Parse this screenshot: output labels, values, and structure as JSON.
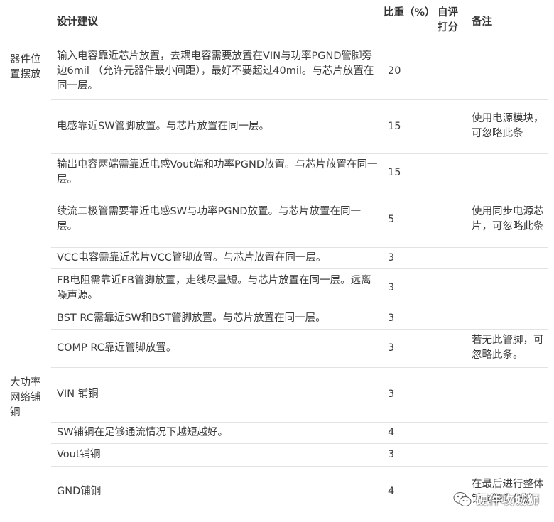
{
  "header": {
    "suggestion": "设计建议",
    "weight": "比重（%）",
    "self_score": "自评打分",
    "note": "备注"
  },
  "groups": [
    {
      "category": "器件位置摆放",
      "rows": [
        {
          "suggestion": "输入电容靠近芯片放置，去耦电容需要放置在VIN与功率PGND管脚旁边6mil （允许元器件最小间距），最好不要超过40mil。与芯片放置在同一层。",
          "weight": "20",
          "score": "",
          "note": ""
        },
        {
          "suggestion": "电感靠近SW管脚放置。与芯片放置在同一层。",
          "weight": "15",
          "score": "",
          "note": "使用电源模块，可忽略此条"
        },
        {
          "suggestion": "输出电容两端需靠近电感Vout端和功率PGND放置。与芯片放置在同一层。",
          "weight": "15",
          "score": "",
          "note": ""
        },
        {
          "suggestion": "续流二极管需要靠近电感SW与功率PGND放置。与芯片放置在同一层。",
          "weight": "5",
          "score": "",
          "note": "使用同步电源芯片，可忽略此条"
        },
        {
          "suggestion": "VCC电容需靠近芯片VCC管脚放置。与芯片放置在同一层。",
          "weight": "3",
          "score": "",
          "note": ""
        },
        {
          "suggestion": "FB电阻需靠近FB管脚放置，走线尽量短。与芯片放置在同一层。远离噪声源。",
          "weight": "3",
          "score": "",
          "note": ""
        },
        {
          "suggestion": "BST RC需靠近SW和BST管脚放置。与芯片放置在同一层。",
          "weight": "3",
          "score": "",
          "note": ""
        },
        {
          "suggestion": "COMP RC靠近管脚放置。",
          "weight": "3",
          "score": "",
          "note": "若无此管脚，可忽略此条。"
        }
      ]
    },
    {
      "category": "大功率网络铺铜",
      "rows": [
        {
          "suggestion": "VIN 铺铜",
          "weight": "3",
          "score": "",
          "note": ""
        },
        {
          "suggestion": "SW铺铜在足够通流情况下越短越好。",
          "weight": "4",
          "score": "",
          "note": ""
        },
        {
          "suggestion": "Vout铺铜",
          "weight": "3",
          "score": "",
          "note": ""
        },
        {
          "suggestion": "GND铺铜",
          "weight": "4",
          "score": "",
          "note": "在最后进行整体铺铜较为便捷。"
        }
      ]
    }
  ],
  "watermark": {
    "text": "硬件攻城狮",
    "icon": "wechat-logo-icon"
  }
}
